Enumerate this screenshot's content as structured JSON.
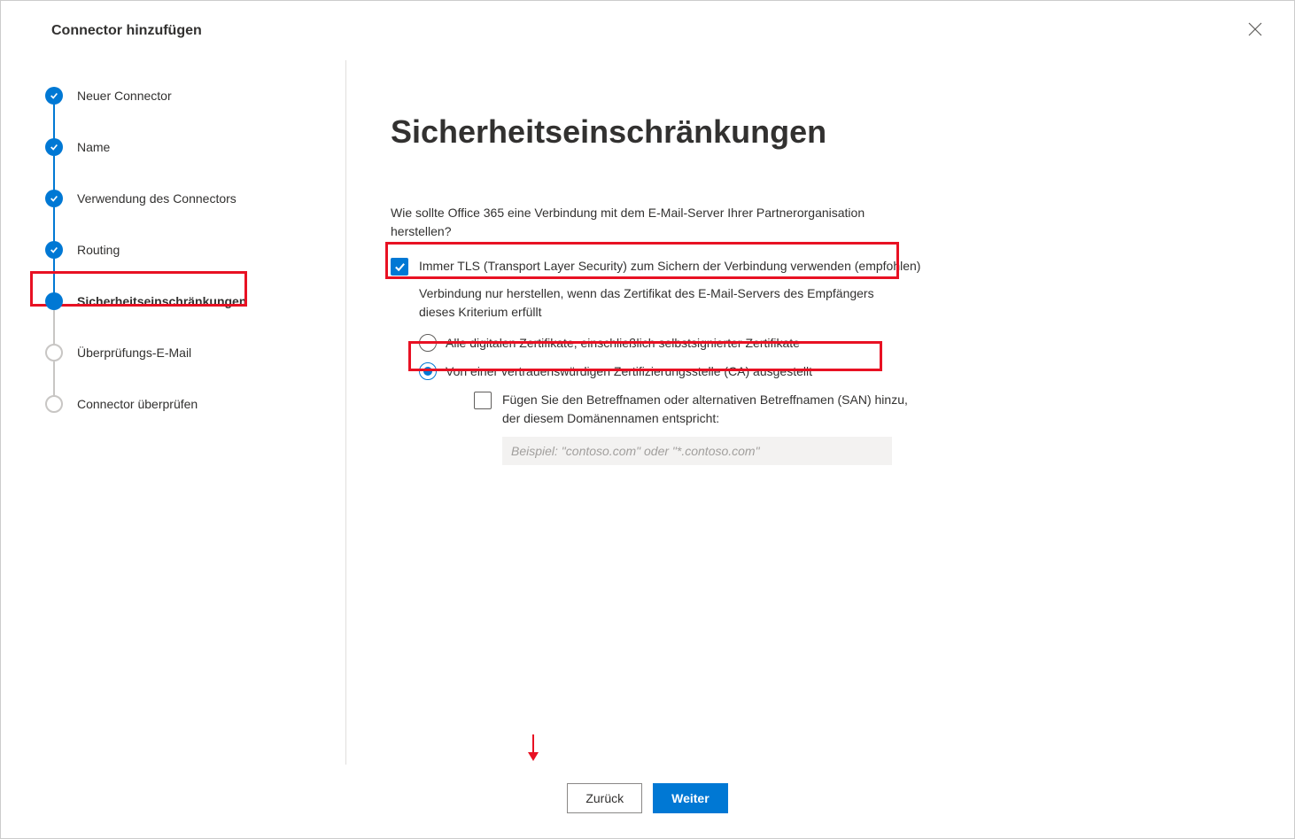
{
  "dialog": {
    "title": "Connector hinzufügen"
  },
  "wizard": {
    "steps": [
      {
        "label": "Neuer Connector",
        "state": "done"
      },
      {
        "label": "Name",
        "state": "done"
      },
      {
        "label": "Verwendung des Connectors",
        "state": "done"
      },
      {
        "label": "Routing",
        "state": "done"
      },
      {
        "label": "Sicherheitseinschränkungen",
        "state": "current"
      },
      {
        "label": "Überprüfungs-E-Mail",
        "state": "pending"
      },
      {
        "label": "Connector überprüfen",
        "state": "pending"
      }
    ]
  },
  "main": {
    "heading": "Sicherheitseinschränkungen",
    "question": "Wie sollte Office 365 eine Verbindung mit dem E-Mail-Server Ihrer Partnerorganisation herstellen?",
    "tls_checkbox": {
      "checked": true,
      "label": "Immer TLS (Transport Layer Security) zum Sichern der Verbindung verwenden (empfohlen)"
    },
    "subtext": "Verbindung nur herstellen, wenn das Zertifikat des E-Mail-Servers des Empfängers dieses Kriterium erfüllt",
    "radios": {
      "option_all": "Alle digitalen Zertifikate, einschließlich selbstsignierter Zertifikate",
      "option_ca": "Von einer vertrauenswürdigen Zertifizierungsstelle (CA) ausgestellt",
      "selected": "ca"
    },
    "san": {
      "checked": false,
      "label": "Fügen Sie den Betreffnamen oder alternativen Betreffnamen (SAN) hinzu, der diesem Domänennamen entspricht:",
      "placeholder": "Beispiel: \"contoso.com\" oder \"*.contoso.com\"",
      "value": ""
    }
  },
  "footer": {
    "back": "Zurück",
    "next": "Weiter"
  }
}
